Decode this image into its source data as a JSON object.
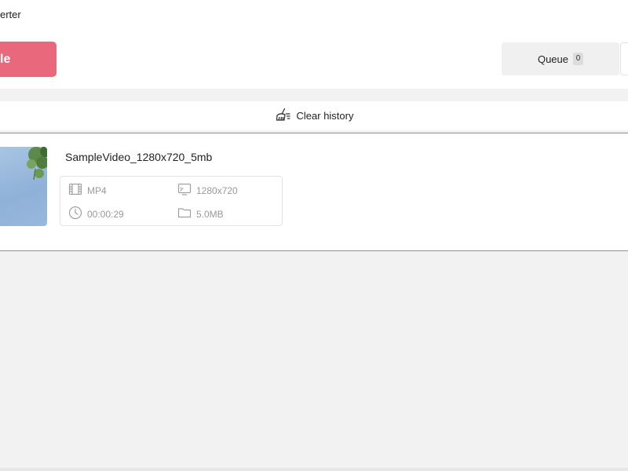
{
  "app": {
    "title": "erter"
  },
  "toolbar": {
    "add_label": "le"
  },
  "tabs": {
    "queue_label": "Queue",
    "queue_count": "0"
  },
  "history": {
    "clear_label": "Clear history"
  },
  "file": {
    "name": "SampleVideo_1280x720_5mb",
    "format": "MP4",
    "resolution": "1280x720",
    "duration": "00:00:29",
    "size": "5.0MB"
  },
  "icons": {
    "clear": "broom-icon",
    "format": "film-icon",
    "resolution": "screen-icon",
    "duration": "clock-icon",
    "size": "folder-icon"
  },
  "colors": {
    "accent": "#e9687c",
    "card_border": "#dc6e80",
    "meta_text": "#9a9a9a"
  }
}
